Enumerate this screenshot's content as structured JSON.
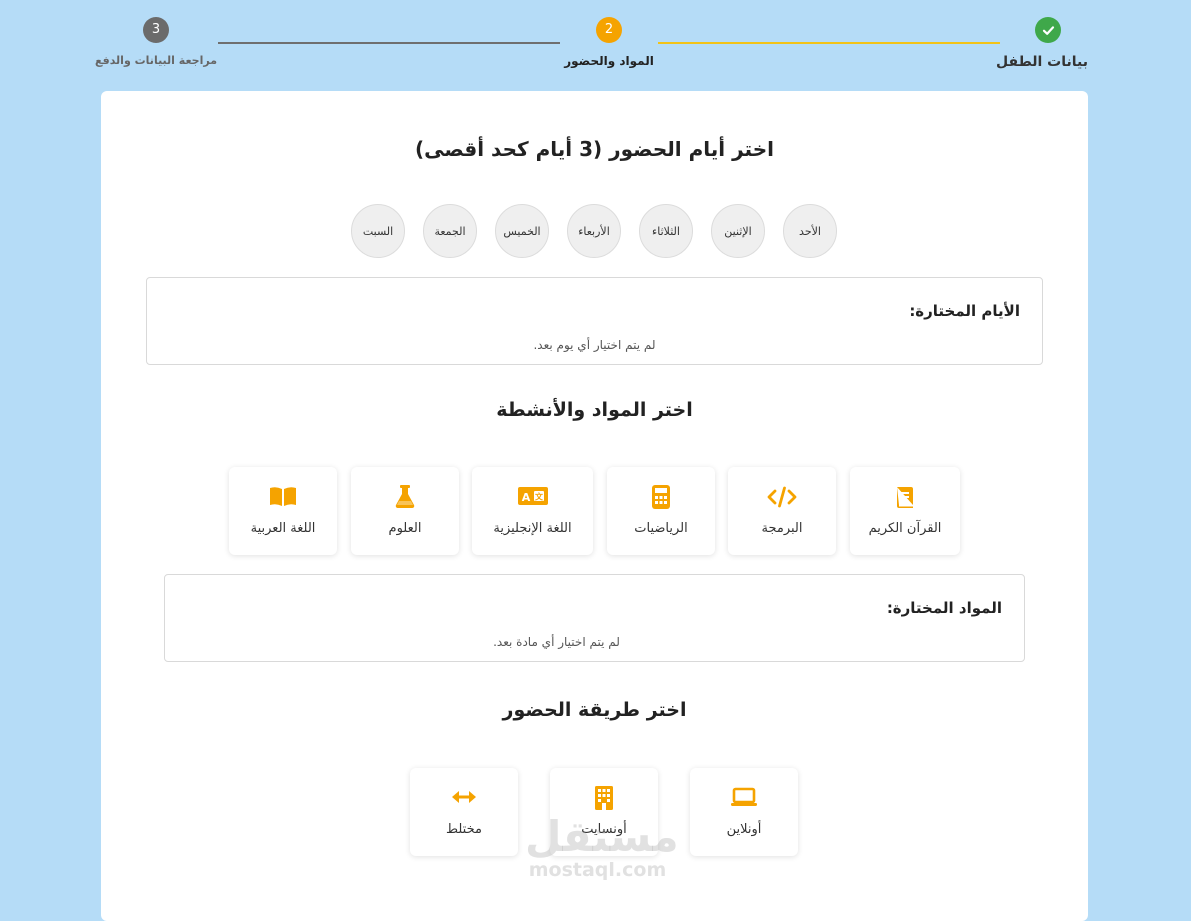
{
  "stepper": {
    "steps": [
      {
        "label": "بيانات الطفل",
        "status": "completed",
        "icon": "check-icon"
      },
      {
        "label": "المواد والحضور",
        "number": "2",
        "status": "current"
      },
      {
        "label": "مراجعة البيانات والدفع",
        "number": "3",
        "status": "upcoming"
      }
    ]
  },
  "days": {
    "title": "اختر أيام الحضور  (3 أيام كحد أقصى)",
    "options": [
      "الأحد",
      "الإثنين",
      "الثلاثاء",
      "الأربعاء",
      "الخميس",
      "الجمعة",
      "السبت"
    ],
    "selected_title": "الأيام المختارة:",
    "selected_empty": "لم يتم اختيار أي يوم بعد."
  },
  "subjects": {
    "title": "اختر المواد والأنشطة",
    "items": [
      {
        "label": "القرآن الكريم",
        "icon": "quran-book-icon"
      },
      {
        "label": "البرمجة",
        "icon": "code-icon"
      },
      {
        "label": "الرياضيات",
        "icon": "calculator-icon"
      },
      {
        "label": "اللغة الإنجليزية",
        "icon": "language-icon"
      },
      {
        "label": "العلوم",
        "icon": "flask-icon"
      },
      {
        "label": "اللغة العربية",
        "icon": "open-book-icon"
      }
    ],
    "selected_title": "المواد المختارة:",
    "selected_empty": "لم يتم اختيار أي مادة بعد."
  },
  "mode": {
    "title": "اختر طريقة الحضور",
    "items": [
      {
        "label": "أونلاين",
        "icon": "laptop-icon"
      },
      {
        "label": "أونسايت",
        "icon": "building-icon"
      },
      {
        "label": "مختلط",
        "icon": "arrows-horizontal-icon"
      }
    ]
  },
  "watermark": {
    "arabic": "مستقل",
    "latin": "mostaql.com"
  },
  "colors": {
    "accent": "#f5a300",
    "success": "#3fa84a",
    "page_bg": "#b5dcf7",
    "inactive": "#6b6b6b"
  }
}
